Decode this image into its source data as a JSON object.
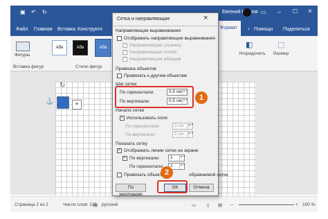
{
  "title_bar": {
    "user": "Евгений Каиров"
  },
  "ribbon": {
    "tabs": [
      "Файл",
      "Главная",
      "Вставка",
      "Конструкто",
      "Формат",
      "Помощн",
      "Поделиться"
    ],
    "left_group": {
      "shapes_label": "Фигуры",
      "group_label": "Вставка фигур"
    },
    "styles": {
      "sample": "Абв",
      "group_label": "Стили фигур"
    },
    "right": {
      "arrange": "Упорядочить",
      "size": "Размер"
    }
  },
  "dialog": {
    "title": "Сетка и направляющие",
    "section_alignment": "Направляющие выравнивания",
    "show_alignment": "Отображать направляющие выравнивания",
    "page_guides": "Направляющие страниц",
    "margin_guides": "Направляющие полей",
    "paragraph_guides": "Направляющие абзацев",
    "section_snap": "Привязка объектов",
    "snap_objects": "Привязать к другим объектам",
    "section_grid": "Шаг сетки",
    "horizontal": "По горизонтали:",
    "horizontal_value": "0,5 см",
    "vertical": "По вертикали:",
    "vertical_value": "0,5 см",
    "section_origin": "Начало сетки",
    "use_margins": "Использовать поля",
    "origin_horizontal": "По горизонтали:",
    "origin_horizontal_value": "3 см",
    "origin_vertical": "По вертикали:",
    "origin_vertical_value": "2 см",
    "section_show": "Показать сетку",
    "show_gridlines": "Отображать линии сетки на экране",
    "show_vertical": "По вертикали:",
    "show_vertical_value": "1",
    "show_horizontal": "По горизонтали:",
    "show_horizontal_value": "1",
    "snap_grid": "Привязать объекты к сетке, если сетка не отображается",
    "snap_grid_visible": "Привязать объекты к",
    "snap_grid_tail": "ображаемой сетке",
    "default_button": "По умолчанию",
    "ok_button": "ОК",
    "cancel_button": "Отмена",
    "close_glyph": "×"
  },
  "callouts": {
    "one": "1",
    "two": "2"
  },
  "status_bar": {
    "page": "Страница 2 из 2",
    "words": "Число слов: 115",
    "language": "русский",
    "zoom": "100 %"
  },
  "colors": {
    "accent": "#2b579a",
    "callout": "#e06a10",
    "highlight": "#d9342b"
  }
}
